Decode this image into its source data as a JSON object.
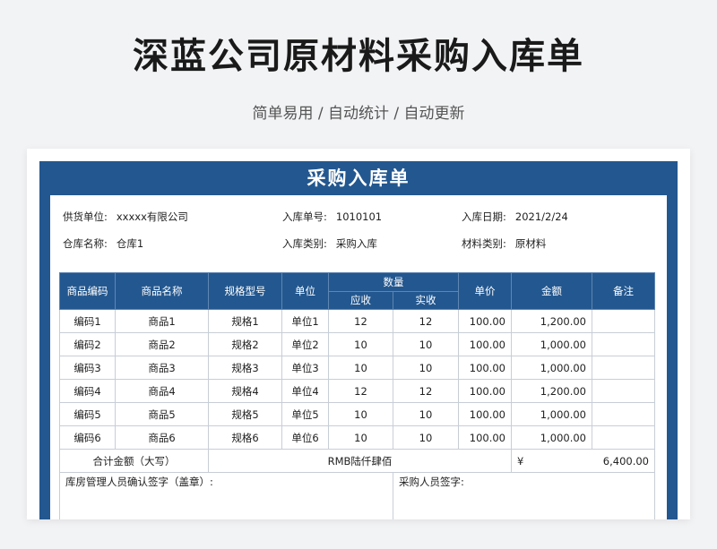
{
  "hero": {
    "title": "深蓝公司原材料采购入库单",
    "subtitle": "简单易用 / 自动统计 / 自动更新"
  },
  "sheet": {
    "title": "采购入库单",
    "info": [
      [
        {
          "label": "供货单位:",
          "value": "xxxxx有限公司"
        },
        {
          "label": "入库单号:",
          "value": "1010101"
        },
        {
          "label": "入库日期:",
          "value": "2021/2/24"
        }
      ],
      [
        {
          "label": "仓库名称:",
          "value": "仓库1"
        },
        {
          "label": "入库类别:",
          "value": "采购入库"
        },
        {
          "label": "材料类别:",
          "value": "原材料"
        }
      ]
    ],
    "headers": {
      "code": "商品编码",
      "name": "商品名称",
      "spec": "规格型号",
      "unit": "单位",
      "qty": "数量",
      "qty_due": "应收",
      "qty_actual": "实收",
      "price": "单价",
      "amount": "金额",
      "note": "备注"
    },
    "rows": [
      {
        "code": "编码1",
        "name": "商品1",
        "spec": "规格1",
        "unit": "单位1",
        "due": "12",
        "actual": "12",
        "price": "100.00",
        "amount": "1,200.00",
        "note": ""
      },
      {
        "code": "编码2",
        "name": "商品2",
        "spec": "规格2",
        "unit": "单位2",
        "due": "10",
        "actual": "10",
        "price": "100.00",
        "amount": "1,000.00",
        "note": ""
      },
      {
        "code": "编码3",
        "name": "商品3",
        "spec": "规格3",
        "unit": "单位3",
        "due": "10",
        "actual": "10",
        "price": "100.00",
        "amount": "1,000.00",
        "note": ""
      },
      {
        "code": "编码4",
        "name": "商品4",
        "spec": "规格4",
        "unit": "单位4",
        "due": "12",
        "actual": "12",
        "price": "100.00",
        "amount": "1,200.00",
        "note": ""
      },
      {
        "code": "编码5",
        "name": "商品5",
        "spec": "规格5",
        "unit": "单位5",
        "due": "10",
        "actual": "10",
        "price": "100.00",
        "amount": "1,000.00",
        "note": ""
      },
      {
        "code": "编码6",
        "name": "商品6",
        "spec": "规格6",
        "unit": "单位6",
        "due": "10",
        "actual": "10",
        "price": "100.00",
        "amount": "1,000.00",
        "note": ""
      }
    ],
    "total": {
      "label": "合计金额（大写）",
      "words": "RMB陆仟肆佰",
      "currency": "¥",
      "value": "6,400.00"
    },
    "signatures": {
      "warehouse": "库房管理人员确认签字（盖章）:",
      "purchaser": "采购人员签字:"
    }
  },
  "colors": {
    "primary": "#23578f",
    "background": "#f2f3f5"
  }
}
